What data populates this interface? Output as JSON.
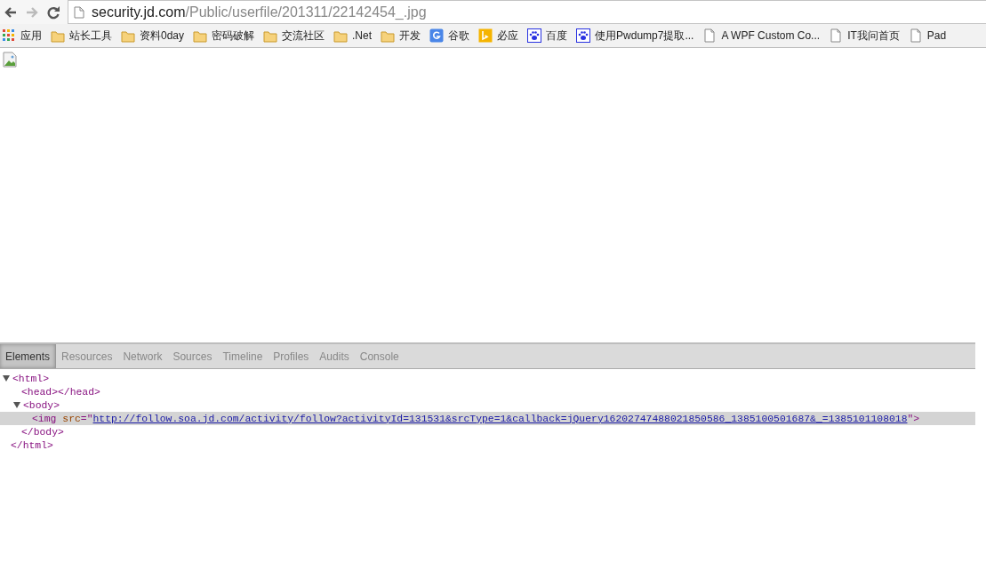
{
  "toolbar": {
    "address": {
      "host": "security.jd.com",
      "path": "/Public/userfile/201311/22142454_.jpg"
    },
    "forward_disabled": true
  },
  "bookmarks": [
    {
      "kind": "apps",
      "label": "应用"
    },
    {
      "kind": "folder",
      "label": "站长工具"
    },
    {
      "kind": "folder",
      "label": "资料0day"
    },
    {
      "kind": "folder",
      "label": "密码破解"
    },
    {
      "kind": "folder",
      "label": "交流社区"
    },
    {
      "kind": "folder",
      "label": ".Net"
    },
    {
      "kind": "folder",
      "label": "开发"
    },
    {
      "kind": "google",
      "label": "谷歌"
    },
    {
      "kind": "bing",
      "label": "必应"
    },
    {
      "kind": "paw",
      "label": "百度"
    },
    {
      "kind": "paw",
      "label": "使用Pwdump7提取..."
    },
    {
      "kind": "page",
      "label": "A WPF Custom Co..."
    },
    {
      "kind": "page",
      "label": "IT我问首页"
    },
    {
      "kind": "page",
      "label": "Pad"
    }
  ],
  "devtools": {
    "tabs": [
      {
        "label": "Elements",
        "selected": true
      },
      {
        "label": "Resources",
        "selected": false
      },
      {
        "label": "Network",
        "selected": false
      },
      {
        "label": "Sources",
        "selected": false
      },
      {
        "label": "Timeline",
        "selected": false
      },
      {
        "label": "Profiles",
        "selected": false
      },
      {
        "label": "Audits",
        "selected": false
      },
      {
        "label": "Console",
        "selected": false
      }
    ],
    "tree": [
      {
        "kind": "element",
        "open": "<html>",
        "close": "</html>",
        "expanded": true,
        "children": [
          {
            "kind": "leaf",
            "open": "<head></head>"
          },
          {
            "kind": "element",
            "open": "<body>",
            "close": "</body>",
            "expanded": true,
            "children": [
              {
                "kind": "img",
                "open": "<img",
                "attr": "src",
                "eq": "=\"",
                "value": "http://follow.soa.jd.com/activity/follow?activityId=131531&srcType=1&callback=jQuery16202747488021850586_1385100501687&_=1385101108018",
                "end": "\">",
                "selected": true
              }
            ]
          }
        ]
      }
    ]
  }
}
